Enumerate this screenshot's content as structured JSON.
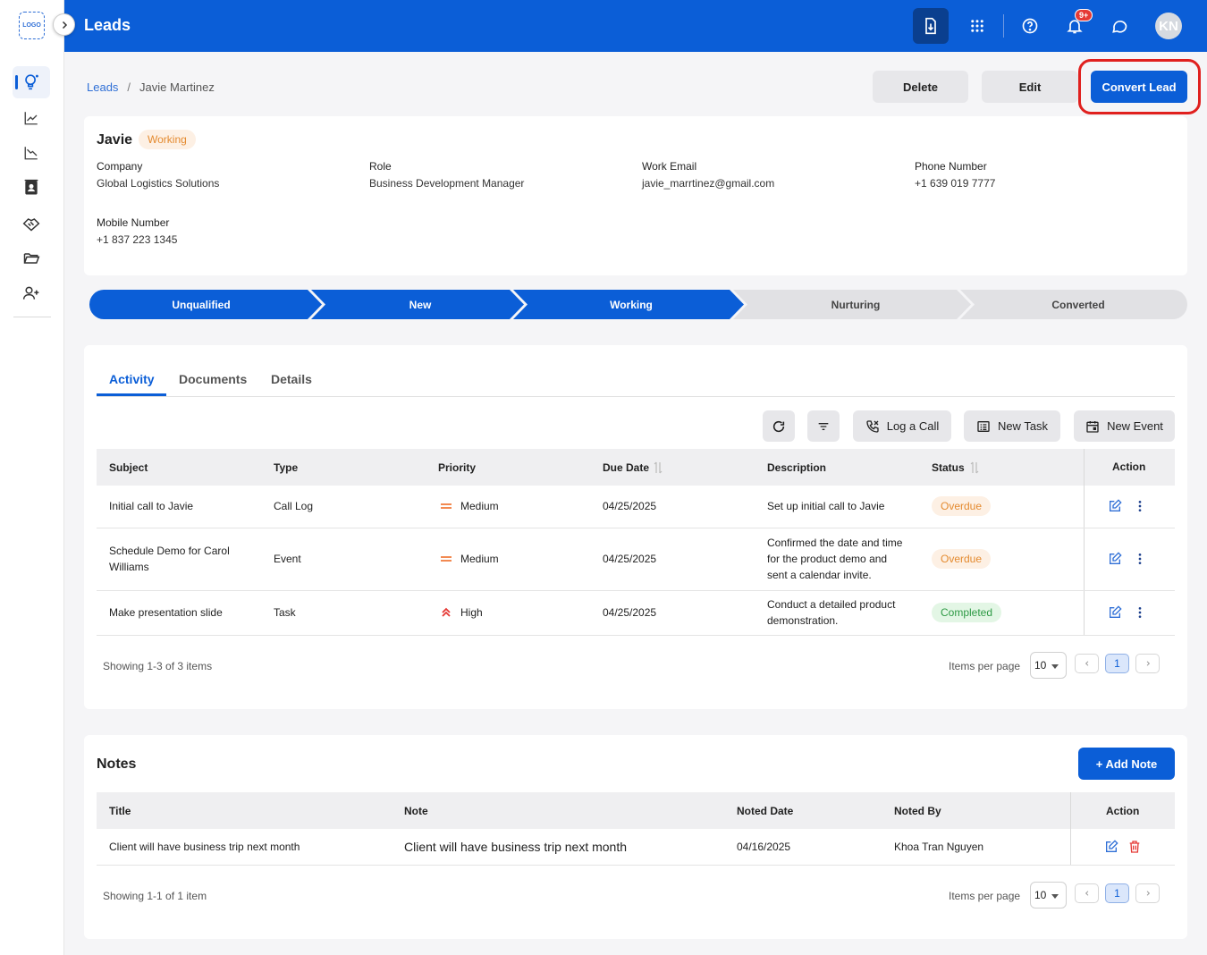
{
  "sidebar": {
    "logo_text": "LOGO"
  },
  "topbar": {
    "title": "Leads",
    "notification_badge": "9+",
    "avatar_initials": "KN"
  },
  "breadcrumb": {
    "root": "Leads",
    "separator": "/",
    "current": "Javie Martinez"
  },
  "header_actions": {
    "delete": "Delete",
    "edit": "Edit",
    "convert": "Convert Lead"
  },
  "lead": {
    "name": "Javie",
    "status": "Working",
    "fields": [
      {
        "label": "Company",
        "value": "Global Logistics Solutions"
      },
      {
        "label": "Role",
        "value": "Business Development Manager"
      },
      {
        "label": "Work Email",
        "value": "javie_marrtinez@gmail.com"
      },
      {
        "label": "Phone Number",
        "value": "+1 639 019 7777"
      },
      {
        "label": "Mobile Number",
        "value": "+1 837 223 1345"
      }
    ]
  },
  "stages": [
    {
      "label": "Unqualified",
      "state": "done"
    },
    {
      "label": "New",
      "state": "done"
    },
    {
      "label": "Working",
      "state": "done"
    },
    {
      "label": "Nurturing",
      "state": "todo"
    },
    {
      "label": "Converted",
      "state": "todo"
    }
  ],
  "tabs": [
    "Activity",
    "Documents",
    "Details"
  ],
  "activity_toolbar": {
    "log_call": "Log a Call",
    "new_task": "New Task",
    "new_event": "New Event"
  },
  "activity_table": {
    "columns": [
      "Subject",
      "Type",
      "Priority",
      "Due Date",
      "Description",
      "Status",
      "Action"
    ],
    "rows": [
      {
        "subject": "Initial call to Javie",
        "type": "Call Log",
        "priority": "Medium",
        "due": "04/25/2025",
        "description": "Set up initial call to Javie",
        "status": "Overdue"
      },
      {
        "subject": "Schedule Demo for Carol Williams",
        "type": "Event",
        "priority": "Medium",
        "due": "04/25/2025",
        "description": "Confirmed the date and time for the product demo and sent a calendar invite.",
        "status": "Overdue"
      },
      {
        "subject": "Make presentation slide",
        "type": "Task",
        "priority": "High",
        "due": "04/25/2025",
        "description": "Conduct a detailed product demonstration.",
        "status": "Completed"
      }
    ],
    "showing": "Showing 1-3 of 3 items",
    "items_per_page_label": "Items per page",
    "items_per_page": "10",
    "current_page": "1"
  },
  "notes": {
    "title": "Notes",
    "add_button": "+ Add Note",
    "columns": [
      "Title",
      "Note",
      "Noted Date",
      "Noted By",
      "Action"
    ],
    "rows": [
      {
        "title": "Client will have business trip next month",
        "note": "Client will have business trip next month",
        "date": "04/16/2025",
        "by": "Khoa Tran Nguyen"
      }
    ],
    "showing": "Showing 1-1 of 1 item",
    "items_per_page_label": "Items per page",
    "items_per_page": "10",
    "current_page": "1"
  },
  "colors": {
    "primary": "#0b5ed7",
    "highlight": "#e0201e",
    "overdue": "#e48a2f",
    "completed": "#2e9a45"
  }
}
